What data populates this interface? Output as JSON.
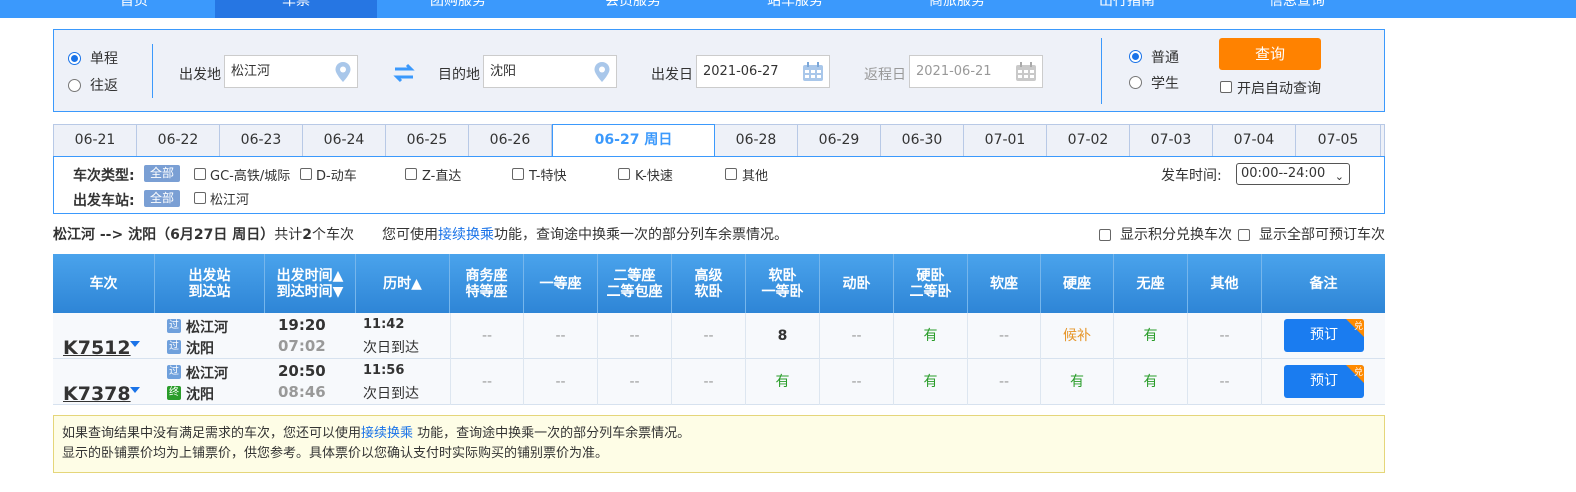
{
  "nav": {
    "items": [
      "首页",
      "车票",
      "团购服务",
      "会员服务",
      "站车服务",
      "商旅服务",
      "出行指南",
      "信息查询"
    ]
  },
  "search": {
    "trip_oneway": "单程",
    "trip_return": "往返",
    "from_label": "出发地",
    "from_value": "松江河",
    "to_label": "目的地",
    "to_value": "沈阳",
    "depart_label": "出发日",
    "depart_value": "2021-06-27",
    "return_label": "返程日",
    "return_value": "2021-06-21",
    "type_normal": "普通",
    "type_student": "学生",
    "query_button": "查询",
    "auto_query": "开启自动查询"
  },
  "dates": [
    {
      "label": "06-21",
      "active": false
    },
    {
      "label": "06-22",
      "active": false
    },
    {
      "label": "06-23",
      "active": false
    },
    {
      "label": "06-24",
      "active": false
    },
    {
      "label": "06-25",
      "active": false
    },
    {
      "label": "06-26",
      "active": false
    },
    {
      "label": "06-27 周日",
      "active": true
    },
    {
      "label": "06-28",
      "active": false
    },
    {
      "label": "06-29",
      "active": false
    },
    {
      "label": "06-30",
      "active": false
    },
    {
      "label": "07-01",
      "active": false
    },
    {
      "label": "07-02",
      "active": false
    },
    {
      "label": "07-03",
      "active": false
    },
    {
      "label": "07-04",
      "active": false
    },
    {
      "label": "07-05",
      "active": false
    }
  ],
  "filters": {
    "type_title": "车次类型:",
    "station_title": "出发车站:",
    "all_chip": "全部",
    "types": [
      "GC-高铁/城际",
      "D-动车",
      "Z-直达",
      "T-特快",
      "K-快速",
      "其他"
    ],
    "station": "松江河",
    "time_label": "发车时间:",
    "time_value": "00:00--24:00"
  },
  "summary": {
    "route": "松江河 --> 沈阳（6月27日 周日）",
    "count_prefix": "共计",
    "count": "2",
    "count_suffix": "个车次",
    "hint_prefix": "您可使用",
    "hint_link": "接续换乘",
    "hint_suffix": "功能，查询途中换乘一次的部分列车余票情况。",
    "opt_points": "显示积分兑换车次",
    "opt_all": "显示全部可预订车次"
  },
  "table": {
    "headers": [
      {
        "l1": "车次",
        "l2": ""
      },
      {
        "l1": "出发站",
        "l2": "到达站"
      },
      {
        "l1": "出发时间▲",
        "l2": "到达时间▼"
      },
      {
        "l1": "历时▲",
        "l2": ""
      },
      {
        "l1": "商务座",
        "l2": "特等座"
      },
      {
        "l1": "一等座",
        "l2": ""
      },
      {
        "l1": "二等座",
        "l2": "二等包座"
      },
      {
        "l1": "高级",
        "l2": "软卧"
      },
      {
        "l1": "软卧",
        "l2": "一等卧"
      },
      {
        "l1": "动卧",
        "l2": ""
      },
      {
        "l1": "硬卧",
        "l2": "二等卧"
      },
      {
        "l1": "软座",
        "l2": ""
      },
      {
        "l1": "硬座",
        "l2": ""
      },
      {
        "l1": "无座",
        "l2": ""
      },
      {
        "l1": "其他",
        "l2": ""
      },
      {
        "l1": "备注",
        "l2": ""
      }
    ],
    "rows": [
      {
        "code": "K7512",
        "from_badge": "过",
        "from": "松江河",
        "to_badge": "过",
        "to": "沈阳",
        "dep": "19:20",
        "arr": "07:02",
        "duration": "11:42",
        "duration_note": "次日到达",
        "seats": [
          "--",
          "--",
          "--",
          "--",
          "8",
          "--",
          "有",
          "--",
          "候补",
          "有",
          "--"
        ],
        "book": "预订",
        "corner": "兑"
      },
      {
        "code": "K7378",
        "from_badge": "过",
        "from": "松江河",
        "to_badge": "终",
        "to": "沈阳",
        "dep": "20:50",
        "arr": "08:46",
        "duration": "11:56",
        "duration_note": "次日到达",
        "seats": [
          "--",
          "--",
          "--",
          "--",
          "有",
          "--",
          "有",
          "--",
          "有",
          "有",
          "--"
        ],
        "book": "预订",
        "corner": "兑"
      }
    ]
  },
  "notice": {
    "line1_prefix": "如果查询结果中没有满足需求的车次，您还可以使用",
    "line1_link": "接续换乘",
    "line1_suffix": " 功能，查询途中换乘一次的部分列车余票情况。",
    "line2": "显示的卧铺票价均为上铺票价，供您参考。具体票价以您确认支付时实际购买的铺别票价为准。"
  },
  "colors": {
    "brand": "#3b99fc",
    "query": "#ff8200",
    "available": "#2a9d2a",
    "waitlist": "#e6962a"
  }
}
